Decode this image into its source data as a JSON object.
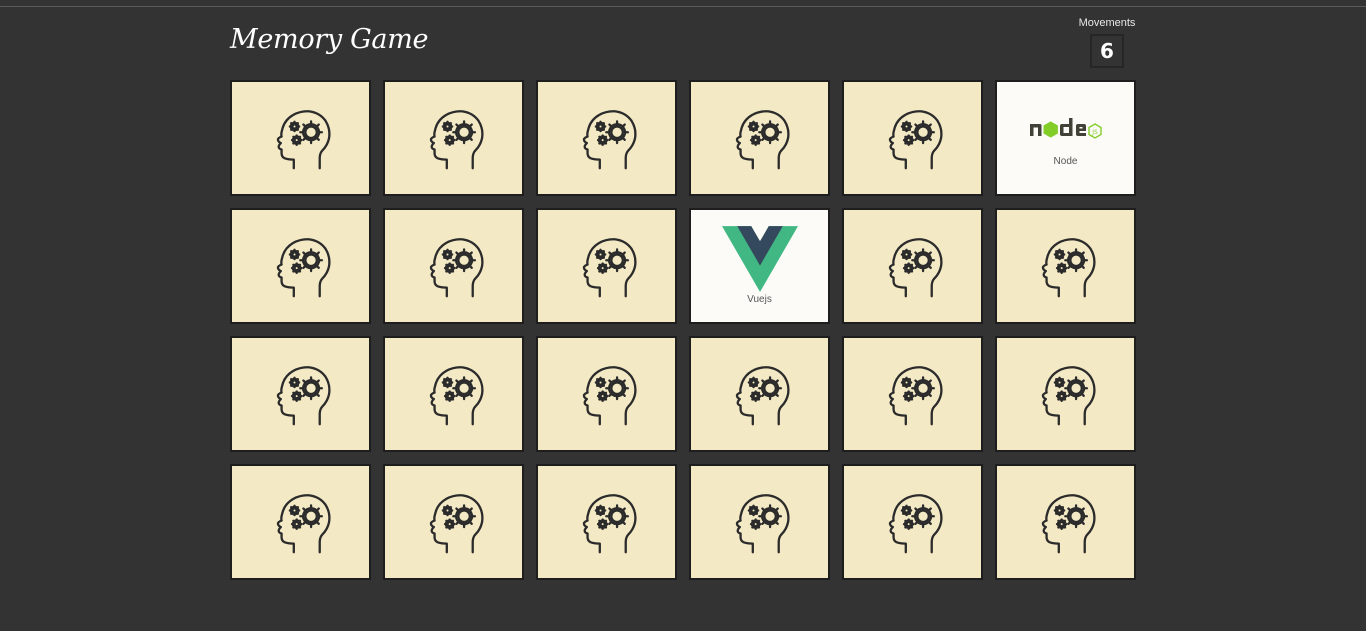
{
  "header": {
    "title": "Memory Game",
    "movements_label": "Movements",
    "movements_count": "6"
  },
  "card_back_icon": "brain-gears-icon",
  "board": {
    "columns": 6,
    "rows": 4,
    "cards": [
      {
        "state": "hidden"
      },
      {
        "state": "hidden"
      },
      {
        "state": "hidden"
      },
      {
        "state": "hidden"
      },
      {
        "state": "hidden"
      },
      {
        "state": "flipped",
        "label": "Node",
        "logo": "node-logo-icon"
      },
      {
        "state": "hidden"
      },
      {
        "state": "hidden"
      },
      {
        "state": "hidden"
      },
      {
        "state": "flipped",
        "label": "Vuejs",
        "logo": "vue-logo-icon"
      },
      {
        "state": "hidden"
      },
      {
        "state": "hidden"
      },
      {
        "state": "hidden"
      },
      {
        "state": "hidden"
      },
      {
        "state": "hidden"
      },
      {
        "state": "hidden"
      },
      {
        "state": "hidden"
      },
      {
        "state": "hidden"
      },
      {
        "state": "hidden"
      },
      {
        "state": "hidden"
      },
      {
        "state": "hidden"
      },
      {
        "state": "hidden"
      },
      {
        "state": "hidden"
      },
      {
        "state": "hidden"
      }
    ]
  },
  "colors": {
    "background": "#333333",
    "card_back": "#f3e9c4",
    "card_face": "#fcfbf7",
    "vue_green": "#41b883",
    "vue_dark": "#35495e",
    "node_green": "#83cd29",
    "node_dark": "#404137"
  }
}
